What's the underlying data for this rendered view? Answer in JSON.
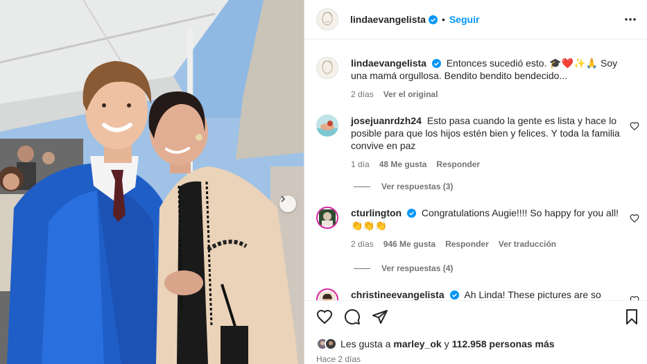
{
  "post": {
    "username": "lindaevangelista",
    "follow_label": "Seguir",
    "separator": "•"
  },
  "caption": {
    "username": "lindaevangelista",
    "text": "Entonces sucedió esto. 🎓❤️✨🙏 Soy una mamá orgullosa. Bendito bendito bendecido...",
    "time": "2 días",
    "see_original": "Ver el original"
  },
  "comments": [
    {
      "username": "josejuanrdzh24",
      "text": "Esto pasa cuando la gente es lista y hace lo posible para que los hijos estén bien y felices. Y toda la familia convive en paz",
      "time": "1 día",
      "likes": "48 Me gusta",
      "reply": "Responder",
      "translate": "",
      "view_replies": "Ver respuestas (3)"
    },
    {
      "username": "cturlington",
      "text": "Congratulations Augie!!!! So happy for you all! 👏👏👏",
      "time": "2 días",
      "likes": "946 Me gusta",
      "reply": "Responder",
      "translate": "Ver traducción",
      "view_replies": "Ver respuestas (4)"
    },
    {
      "username": "christineevangelista",
      "text": "Ah Linda! These pictures are so happy",
      "time": "",
      "likes": "",
      "reply": "",
      "translate": "",
      "view_replies": ""
    }
  ],
  "likes_line": {
    "prefix": "Les gusta a",
    "user": "marley_ok",
    "joiner": "y",
    "others": "112.958 personas más"
  },
  "posted_time": "Hace 2 días",
  "icons": {
    "more": "more-horizontal-icon",
    "like": "heart-icon",
    "comment": "comment-icon",
    "share": "share-icon",
    "save": "bookmark-icon",
    "verified": "verified-badge-icon",
    "next": "chevron-right-icon"
  },
  "colors": {
    "accent": "#0095f6",
    "secondary_text": "#737373",
    "primary_text": "#262626"
  }
}
